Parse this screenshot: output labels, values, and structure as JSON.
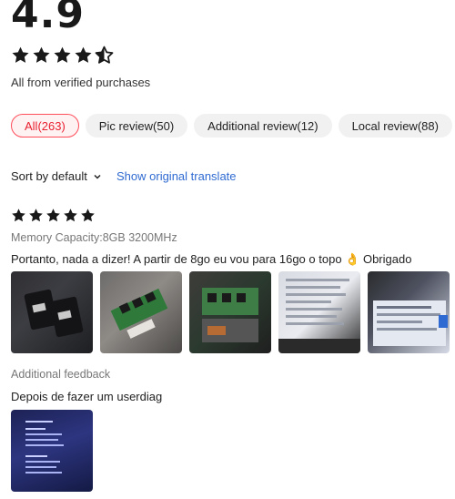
{
  "summary": {
    "rating": "4.9",
    "stars": 4.5,
    "verified_text": "All from verified purchases"
  },
  "filters": [
    {
      "label": "All(263)",
      "active": true
    },
    {
      "label": "Pic review(50)",
      "active": false
    },
    {
      "label": "Additional review(12)",
      "active": false
    },
    {
      "label": "Local review(88)",
      "active": false
    }
  ],
  "sort": {
    "label": "Sort by default",
    "translate_link": "Show original translate"
  },
  "review": {
    "stars": 5,
    "spec": "Memory Capacity:8GB 3200MHz",
    "text": "Portanto, nada a dizer! A partir de 8go eu vou para 16go o topo 👌 Obrigado",
    "photo_count": 5,
    "additional_label": "Additional feedback",
    "additional_text": "Depois de fazer um userdiag"
  },
  "colors": {
    "accent": "#e8202f",
    "link": "#2e6ad1",
    "star": "#191919"
  }
}
